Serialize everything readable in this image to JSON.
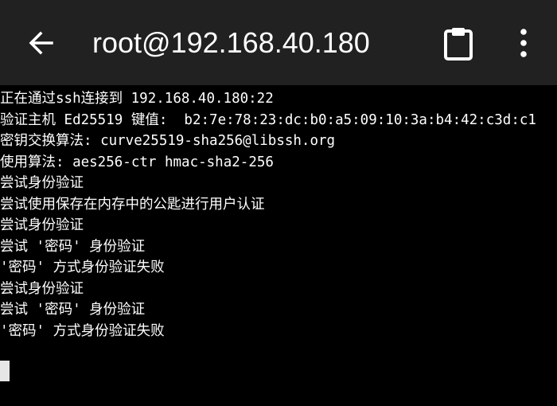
{
  "header": {
    "title": "root@192.168.40.180",
    "back_icon": "arrow-back-icon",
    "clipboard_icon": "clipboard-icon",
    "menu_icon": "more-vert-icon"
  },
  "terminal": {
    "lines": [
      "正在通过ssh连接到 192.168.40.180:22",
      "验证主机 Ed25519 键值:  b2:7e:78:23:dc:b0:a5:09:10:3a:b4:42:c3d:c1",
      "密钥交换算法: curve25519-sha256@libssh.org",
      "使用算法: aes256-ctr hmac-sha2-256",
      "尝试身份验证",
      "尝试使用保存在内存中的公匙进行用户认证",
      "尝试身份验证",
      "尝试 '密码' 身份验证",
      "'密码' 方式身份验证失败",
      "尝试身份验证",
      "尝试 '密码' 身份验证",
      "'密码' 方式身份验证失败"
    ]
  },
  "colors": {
    "toolbar_background": "#212121",
    "terminal_background": "#000000",
    "text": "#ffffff",
    "cursor": "#e6e6e6"
  }
}
